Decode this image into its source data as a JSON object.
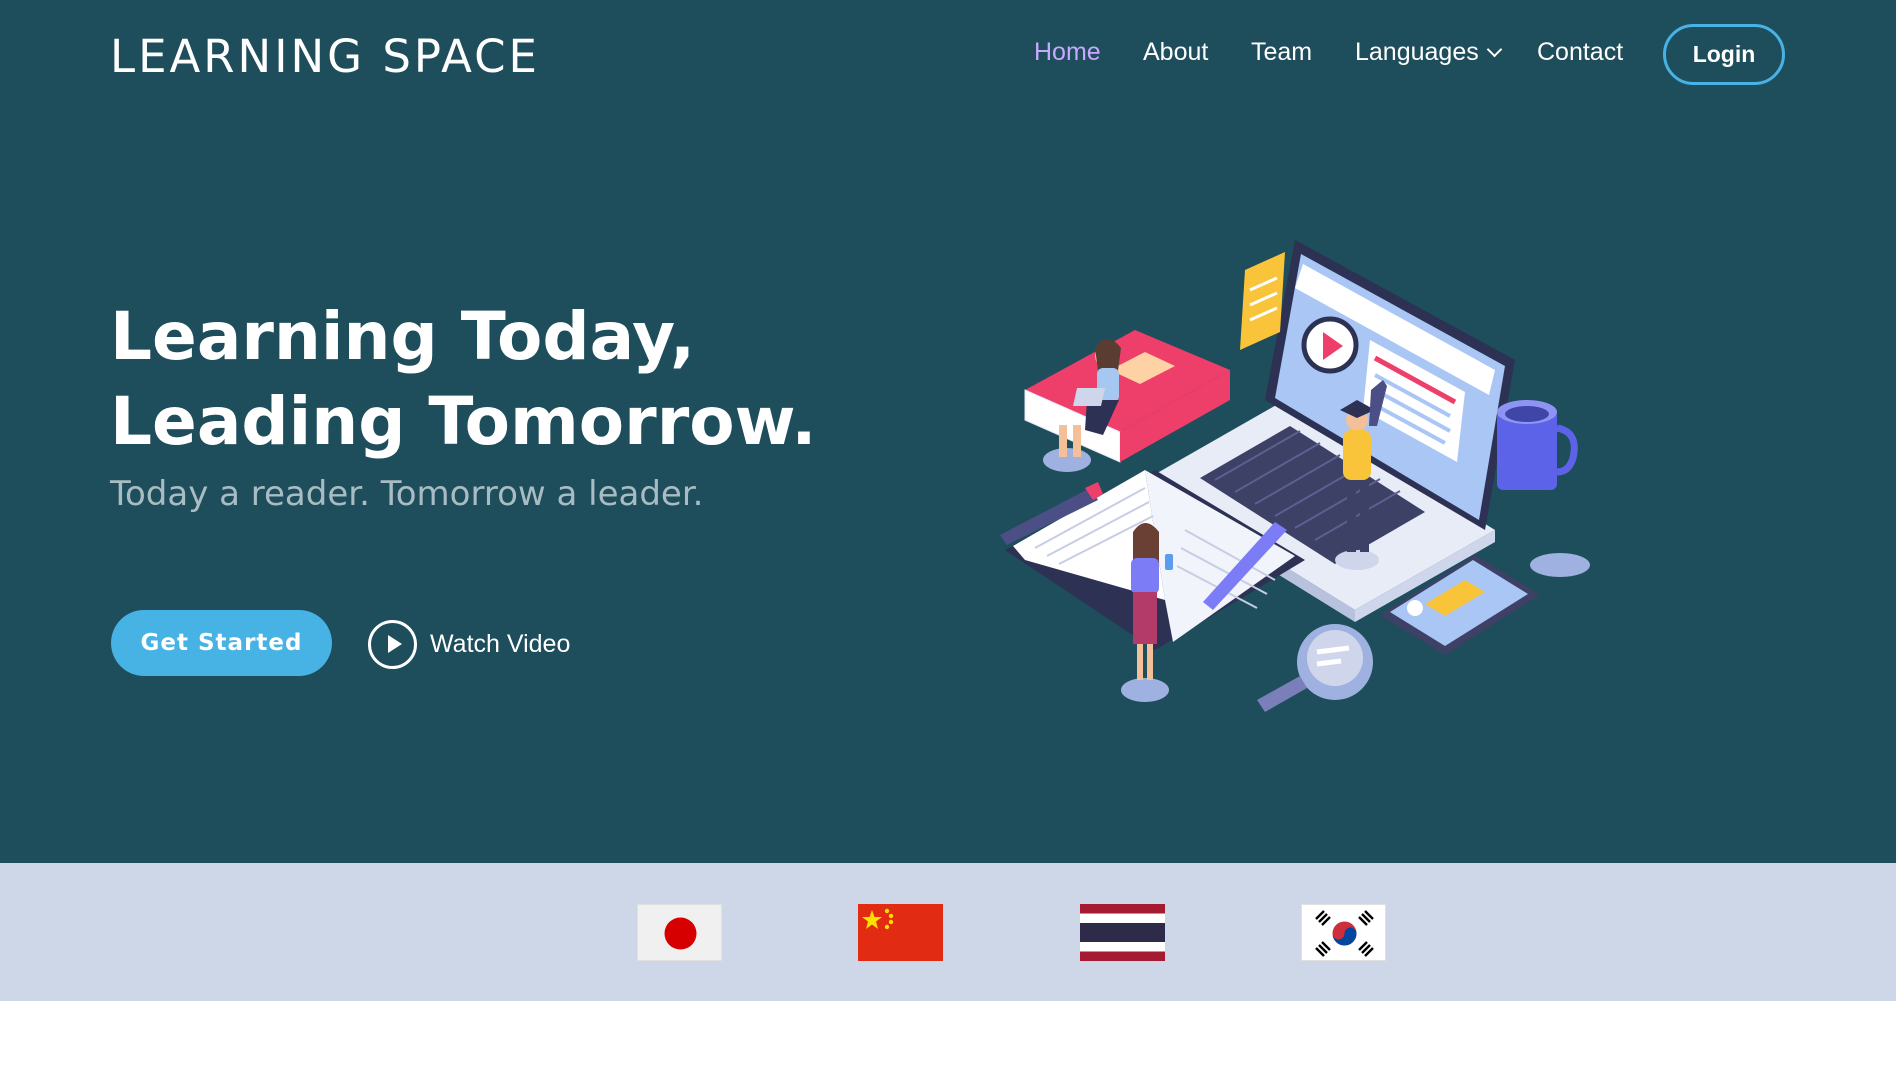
{
  "brand": {
    "name": "LEARNING SPACE"
  },
  "nav": {
    "items": [
      {
        "label": "Home",
        "active": true
      },
      {
        "label": "About"
      },
      {
        "label": "Team"
      },
      {
        "label": "Languages"
      },
      {
        "label": "Contact"
      }
    ],
    "login_label": "Login"
  },
  "hero": {
    "headline": "Learning Today, Leading Tomorrow.",
    "subline": "Today a reader. Tomorrow a leader.",
    "cta_label": "Get Started",
    "watch_label": "Watch Video"
  },
  "languages": {
    "flags": [
      {
        "icon": "japan-flag-icon"
      },
      {
        "icon": "china-flag-icon"
      },
      {
        "icon": "thailand-flag-icon"
      },
      {
        "icon": "south-korea-flag-icon"
      }
    ]
  },
  "colors": {
    "hero_bg": "#1e4d5b",
    "accent": "#47b2e4",
    "nav_active": "#c9a8ff",
    "band_bg": "#cdd7e7"
  }
}
